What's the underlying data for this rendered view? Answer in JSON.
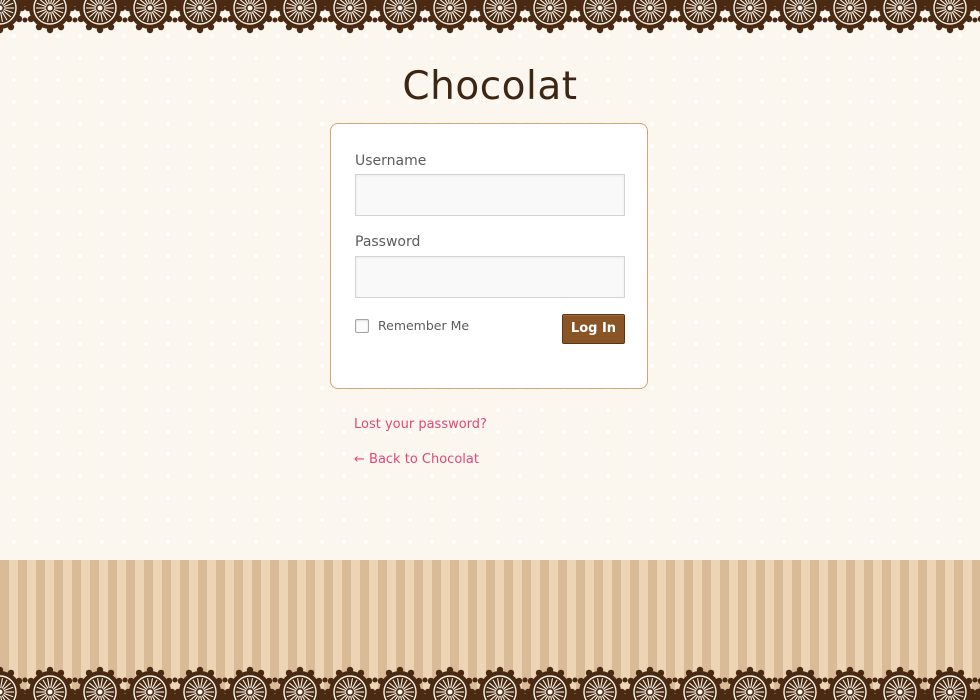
{
  "site": {
    "title": "Chocolat"
  },
  "login_form": {
    "username_label": "Username",
    "username_value": "",
    "password_label": "Password",
    "password_value": "",
    "remember_label": "Remember Me",
    "remember_checked": false,
    "submit_label": "Log In"
  },
  "links": {
    "lost_password": "Lost your password?",
    "back_to_site": "← Back to Chocolat"
  },
  "colors": {
    "background": "#fbf7ee",
    "lace": "#4a2a12",
    "title": "#3e2614",
    "button": "#8a5526",
    "card_border": "#d3a574",
    "link": "#e2477a",
    "stripe_dark": "#d9bb98",
    "stripe_light": "#ecd4b4"
  }
}
